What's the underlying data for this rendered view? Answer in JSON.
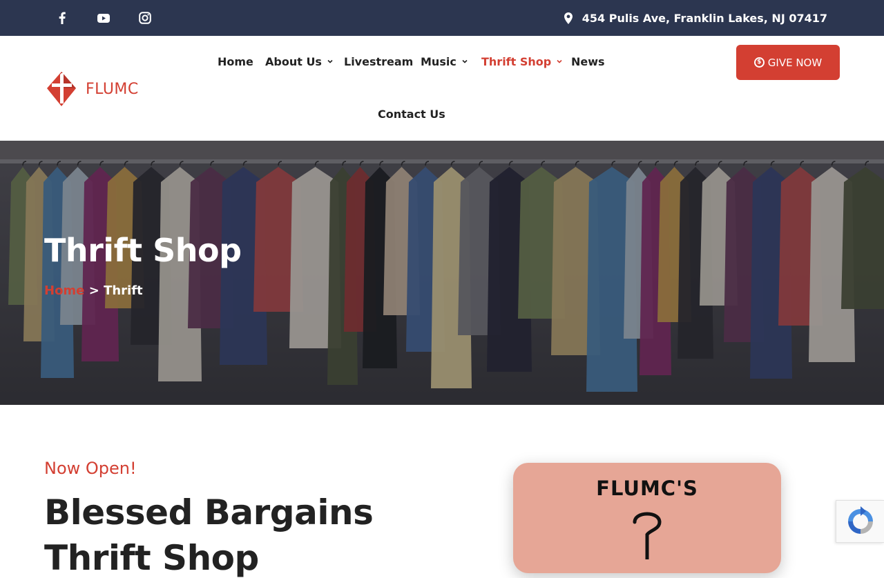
{
  "topbar": {
    "social": [
      {
        "icon": "facebook-icon"
      },
      {
        "icon": "youtube-icon"
      },
      {
        "icon": "instagram-icon"
      }
    ],
    "address": "454 Pulis Ave, Franklin Lakes, NJ 07417",
    "colors": {
      "background": "#2c3650",
      "text": "#ffffff"
    }
  },
  "header": {
    "logo_text": "FLUMC",
    "nav": [
      {
        "label": "Home",
        "dropdown": false,
        "active": false
      },
      {
        "label": "About Us",
        "dropdown": true,
        "active": false
      },
      {
        "label": "Livestream",
        "dropdown": false,
        "active": false
      },
      {
        "label": "Music",
        "dropdown": true,
        "active": false
      },
      {
        "label": "Thrift Shop",
        "dropdown": true,
        "active": true
      },
      {
        "label": "News",
        "dropdown": false,
        "active": false
      },
      {
        "label": "Contact Us",
        "dropdown": false,
        "active": false
      }
    ],
    "give_button": "GIVE NOW",
    "colors": {
      "accent": "#d33f32",
      "nav_text": "#222222"
    }
  },
  "hero": {
    "title": "Thrift Shop",
    "breadcrumb": {
      "home": "Home",
      "separator": ">",
      "current": "Thrift"
    }
  },
  "content": {
    "kicker": "Now Open!",
    "headline_line1": "Blessed Bargains",
    "headline_line2": "Thrift Shop",
    "card": {
      "title": "FLUMC'S",
      "background": "#e6a696"
    }
  }
}
